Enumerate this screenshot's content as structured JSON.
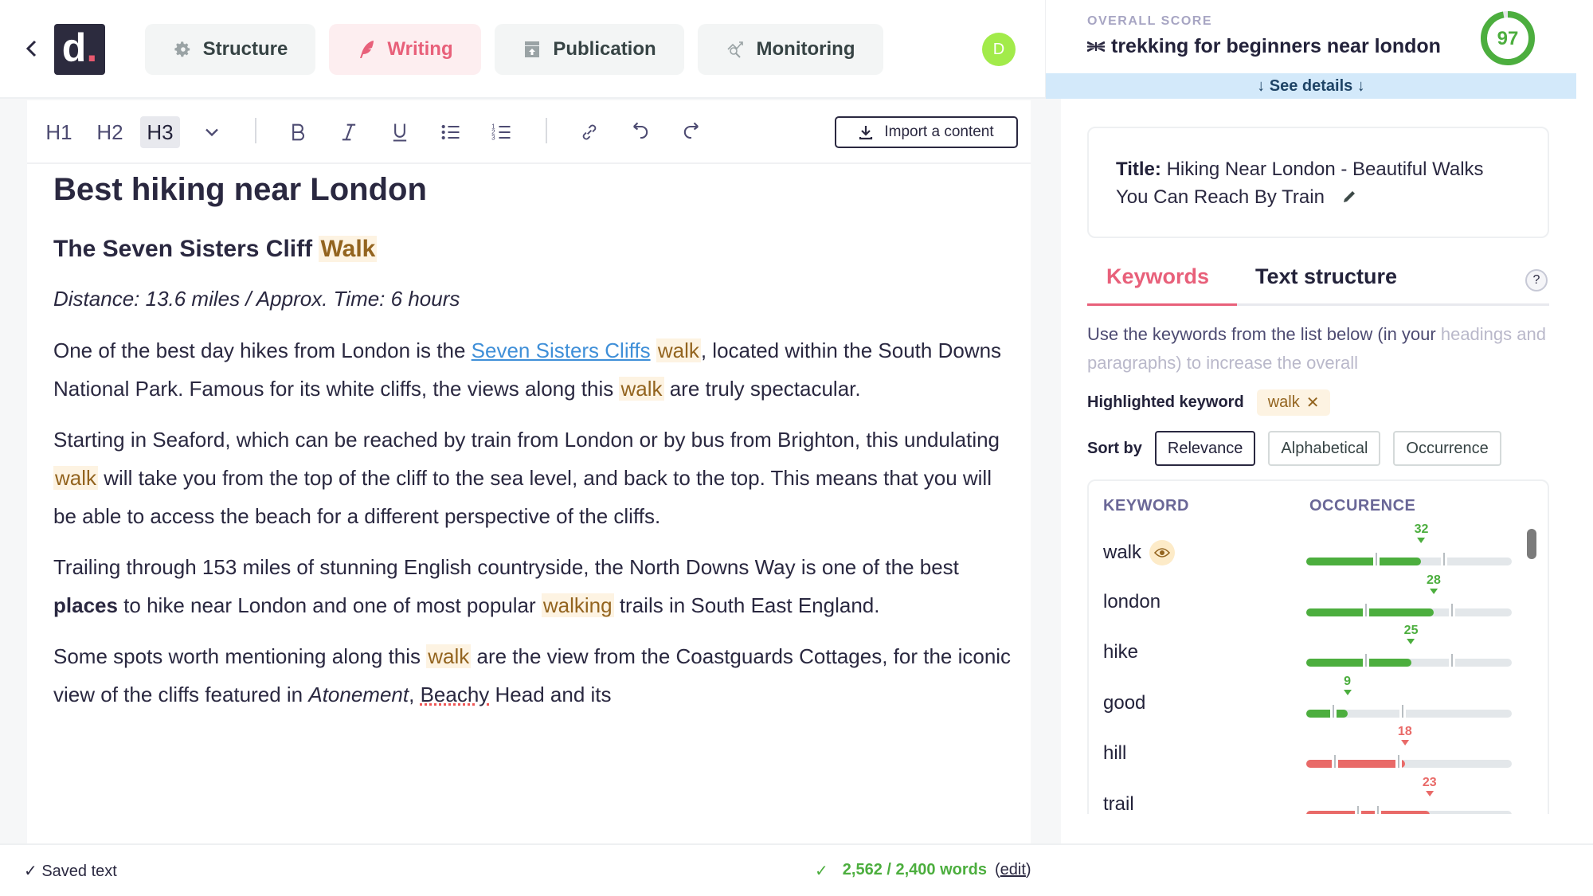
{
  "nav": {
    "back_icon": "chevron-left-icon",
    "logo_letter": "d",
    "logo_dot": ".",
    "tabs": [
      {
        "label": "Structure",
        "icon": "gear-icon",
        "active": false
      },
      {
        "label": "Writing",
        "icon": "feather-icon",
        "active": true
      },
      {
        "label": "Publication",
        "icon": "upload-box-icon",
        "active": false
      },
      {
        "label": "Monitoring",
        "icon": "chart-search-icon",
        "active": false
      }
    ],
    "avatar_initial": "D",
    "avatar_color": "#a2eb4a"
  },
  "score": {
    "label": "OVERALL SCORE",
    "keyword": "trekking for beginners near london",
    "flag": "uk-flag",
    "value": "97",
    "value_fraction": 0.97,
    "color": "#4cae3e",
    "see_details": "↓ See details ↓"
  },
  "toolbar": {
    "headings": [
      "H1",
      "H2",
      "H3"
    ],
    "active_heading": "H3",
    "import_label": "Import a content"
  },
  "document": {
    "h1": "Best hiking near London",
    "h3_text": "The Seven Sisters Cliff ",
    "h3_highlight": "Walk",
    "meta": "Distance: 13.6 miles / Approx. Time: 6 hours",
    "p1": {
      "a": "One of the best day hikes from London is the ",
      "link": "Seven Sisters Cliffs",
      "b": " ",
      "hl1": "walk",
      "c": ", located within the South Downs National Park. Famous for its white cliffs, the views along this ",
      "hl2": "walk",
      "d": " are truly spectacular."
    },
    "p2": {
      "a": "Starting in Seaford, which can be reached by train from London or by bus from Brighton, this undulating ",
      "hl1": "walk",
      "b": " will take you from the top of the cliff to the sea level, and back to the top. This means that you will be able to access the beach for a different perspective of the cliffs."
    },
    "p3": {
      "a": "Trailing through 153 miles of stunning English countryside, the North Downs Way is one of the best ",
      "bold": "places",
      "b": " to hike near London and one of most popular ",
      "hl1": "walking",
      "c": " trails in South East England."
    },
    "p4": {
      "a": "Some spots worth mentioning along this ",
      "hl1": "walk",
      "b": " are the view from the Coastguards Cottages, for the iconic view of the cliffs featured in ",
      "italic": "Atonement",
      "c": ", ",
      "spell": "Beachy",
      "d": " Head and its"
    }
  },
  "footer": {
    "saved": "✓ Saved text",
    "check": "✓",
    "words": "2,562 / 2,400 words",
    "edit_open": "(",
    "edit": "edit",
    "edit_close": ")"
  },
  "panel": {
    "title_label": "Title:",
    "title_text": " Hiking Near London - Beautiful Walks You Can Reach By Train",
    "tabs": [
      "Keywords",
      "Text structure"
    ],
    "active_tab": "Keywords",
    "help": "?",
    "hint_a": "Use the keywords from the list below (in your ",
    "hint_b": "headings and paragraphs) to increase the overall",
    "highlighted_label": "Highlighted keyword",
    "highlighted_value": "walk",
    "highlighted_remove": "✕",
    "sort_label": "Sort by",
    "sort_options": [
      "Relevance",
      "Alphabetical",
      "Occurrence"
    ],
    "sort_active": "Relevance",
    "col_keyword": "KEYWORD",
    "col_occurrence": "OCCURENCE",
    "keywords": [
      {
        "name": "walk",
        "count": "32",
        "fill": 0.56,
        "ticks": [
          0.34,
          0.67
        ],
        "status": "good",
        "highlighted": true
      },
      {
        "name": "london",
        "count": "28",
        "fill": 0.62,
        "ticks": [
          0.29,
          0.71
        ],
        "status": "good",
        "highlighted": false
      },
      {
        "name": "hike",
        "count": "25",
        "fill": 0.51,
        "ticks": [
          0.29,
          0.71
        ],
        "status": "good",
        "highlighted": false
      },
      {
        "name": "good",
        "count": "9",
        "fill": 0.2,
        "ticks": [
          0.13,
          0.47
        ],
        "status": "good",
        "highlighted": false
      },
      {
        "name": "hill",
        "count": "18",
        "fill": 0.48,
        "ticks": [
          0.14,
          0.45
        ],
        "status": "over",
        "highlighted": false
      },
      {
        "name": "trail",
        "count": "23",
        "fill": 0.6,
        "ticks": [
          0.25,
          0.35
        ],
        "status": "over",
        "highlighted": false
      }
    ],
    "colors": {
      "good": "#4cae3e",
      "over": "#e96a68",
      "accent": "#e8607a",
      "highlight_bg": "#fdf3e2",
      "highlight_fg": "#93641f"
    }
  }
}
